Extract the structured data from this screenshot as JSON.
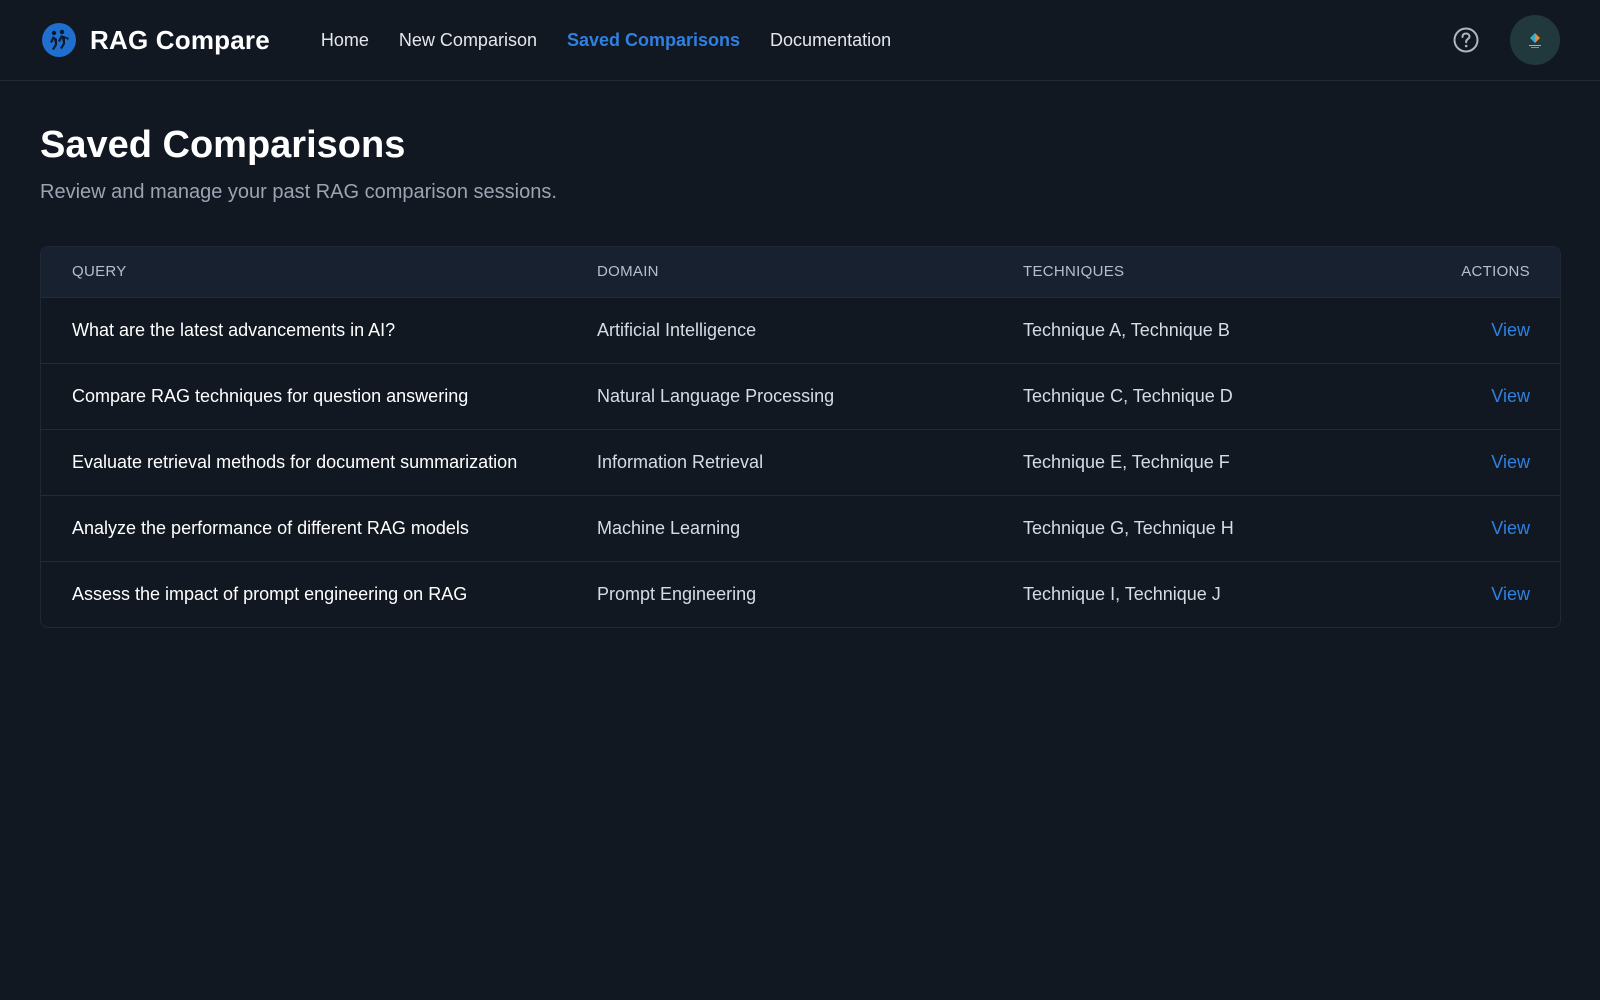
{
  "app": {
    "name": "RAG Compare",
    "logo_icon": "running-figures-logo-icon"
  },
  "nav": {
    "items": [
      {
        "label": "Home"
      },
      {
        "label": "New Comparison"
      },
      {
        "label": "Saved Comparisons",
        "active": true
      },
      {
        "label": "Documentation"
      }
    ]
  },
  "header_icons": {
    "help": "help-circle-icon",
    "avatar": "user-avatar"
  },
  "page": {
    "title": "Saved Comparisons",
    "subtitle": "Review and manage your past RAG comparison sessions."
  },
  "table": {
    "columns": [
      "QUERY",
      "DOMAIN",
      "TECHNIQUES",
      "ACTIONS"
    ],
    "rows": [
      {
        "query": "What are the latest advancements in AI?",
        "domain": "Artificial Intelligence",
        "techniques": "Technique A, Technique B",
        "action": "View"
      },
      {
        "query": "Compare RAG techniques for question answering",
        "domain": "Natural Language Processing",
        "techniques": "Technique C, Technique D",
        "action": "View"
      },
      {
        "query": "Evaluate retrieval methods for document summarization",
        "domain": "Information Retrieval",
        "techniques": "Technique E, Technique F",
        "action": "View"
      },
      {
        "query": "Analyze the performance of different RAG models",
        "domain": "Machine Learning",
        "techniques": "Technique G, Technique H",
        "action": "View"
      },
      {
        "query": "Assess the impact of prompt engineering on RAG",
        "domain": "Prompt Engineering",
        "techniques": "Technique I, Technique J",
        "action": "View"
      }
    ]
  },
  "colors": {
    "background": "#111821",
    "accent": "#2f80e0",
    "table_header": "#172130"
  }
}
